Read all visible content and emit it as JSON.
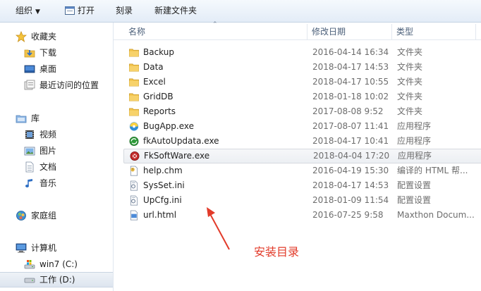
{
  "toolbar": {
    "organize_label": "组织",
    "open_label": "打开",
    "burn_label": "刻录",
    "new_folder_label": "新建文件夹"
  },
  "nav": {
    "favorites": {
      "label": "收藏夹",
      "icon": "star-icon"
    },
    "favorites_items": [
      {
        "label": "下载",
        "icon": "downloads-icon"
      },
      {
        "label": "桌面",
        "icon": "desktop-icon"
      },
      {
        "label": "最近访问的位置",
        "icon": "recent-places-icon"
      }
    ],
    "libraries": {
      "label": "库",
      "icon": "library-icon"
    },
    "library_items": [
      {
        "label": "视频",
        "icon": "video-icon"
      },
      {
        "label": "图片",
        "icon": "pictures-icon"
      },
      {
        "label": "文档",
        "icon": "documents-icon"
      },
      {
        "label": "音乐",
        "icon": "music-icon"
      }
    ],
    "homegroup": {
      "label": "家庭组",
      "icon": "homegroup-icon"
    },
    "computer": {
      "label": "计算机",
      "icon": "computer-icon"
    },
    "drives": [
      {
        "label": "win7 (C:)",
        "icon": "system-drive-icon"
      },
      {
        "label": "工作 (D:)",
        "icon": "drive-icon"
      }
    ]
  },
  "columns": {
    "name": "名称",
    "date": "修改日期",
    "type": "类型"
  },
  "files": [
    {
      "name": "Backup",
      "date": "2016-04-14 16:34",
      "type": "文件夹",
      "icon": "folder-icon"
    },
    {
      "name": "Data",
      "date": "2018-04-17 14:53",
      "type": "文件夹",
      "icon": "folder-icon"
    },
    {
      "name": "Excel",
      "date": "2018-04-17 10:55",
      "type": "文件夹",
      "icon": "folder-icon"
    },
    {
      "name": "GridDB",
      "date": "2018-01-18 10:02",
      "type": "文件夹",
      "icon": "folder-icon"
    },
    {
      "name": "Reports",
      "date": "2017-08-08 9:52",
      "type": "文件夹",
      "icon": "folder-icon"
    },
    {
      "name": "BugApp.exe",
      "date": "2017-08-07 11:41",
      "type": "应用程序",
      "icon": "app-icon"
    },
    {
      "name": "fkAutoUpdata.exe",
      "date": "2018-04-17 10:41",
      "type": "应用程序",
      "icon": "update-app-icon"
    },
    {
      "name": "FkSoftWare.exe",
      "date": "2018-04-04 17:20",
      "type": "应用程序",
      "icon": "software-app-icon",
      "selected": true
    },
    {
      "name": "help.chm",
      "date": "2016-04-19 15:30",
      "type": "编译的 HTML 帮...",
      "icon": "help-file-icon"
    },
    {
      "name": "SysSet.ini",
      "date": "2018-04-17 14:53",
      "type": "配置设置",
      "icon": "ini-file-icon"
    },
    {
      "name": "UpCfg.ini",
      "date": "2018-01-09 11:54",
      "type": "配置设置",
      "icon": "ini-file-icon"
    },
    {
      "name": "url.html",
      "date": "2016-07-25 9:58",
      "type": "Maxthon Docum...",
      "icon": "html-file-icon"
    }
  ],
  "annotation": {
    "text": "安装目录",
    "color": "#e23b2a"
  },
  "colors": {
    "folder": "#f2c34a",
    "selection": "#eceff3",
    "header_text": "#4c607a"
  }
}
